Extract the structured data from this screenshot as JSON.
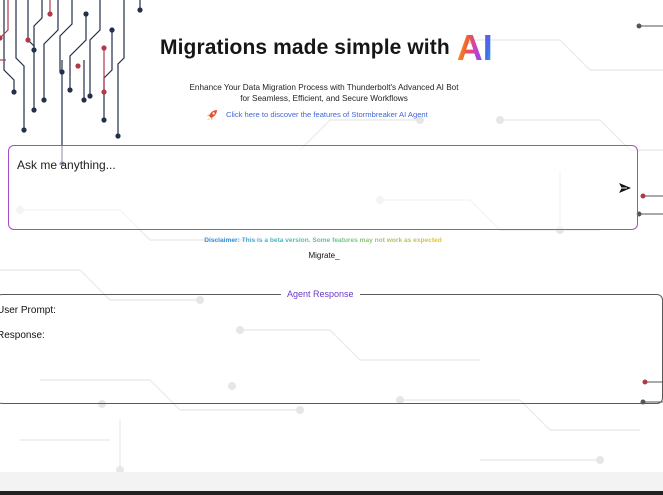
{
  "header": {
    "title": "Migrations made simple with",
    "ai_logo": "AI",
    "subtitle_line1": "Enhance Your Data Migration Process with Thunderbolt's Advanced AI Bot",
    "subtitle_line2": "for Seamless, Efficient, and Secure Workflows",
    "discover_link": "Click here to discover the features of Stormbreaker AI Agent",
    "discover_icon": "rocket-icon"
  },
  "prompt": {
    "placeholder": "Ask me anything...",
    "value": "",
    "send_icon": "send-icon"
  },
  "disclaimer": {
    "label": "Disclaimer:",
    "text": "This is a beta version. Some features may not work as expected"
  },
  "status": {
    "typing_text": "Migrate_"
  },
  "response": {
    "legend": "Agent Response",
    "user_prompt_label": "User Prompt:",
    "user_prompt_value": "",
    "response_label": "Response:",
    "response_value": ""
  },
  "colors": {
    "prompt_border": "#a54cc9",
    "link": "#4266d6",
    "legend": "#6a3bc9",
    "circuit_dark": "#22304a",
    "circuit_light": "#ececec"
  }
}
